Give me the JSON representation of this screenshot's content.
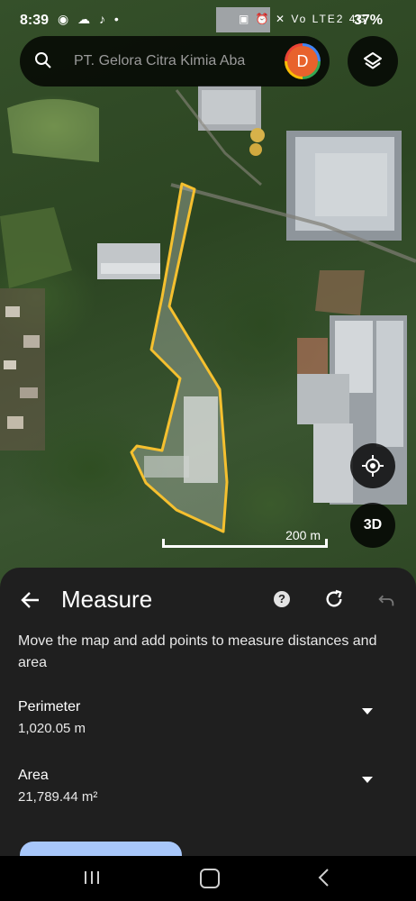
{
  "status_bar": {
    "time": "8:39",
    "left_icons": "◉ ☁ ♪ •",
    "right_icons": "▣ ⏰ ✕ Vo LTE2 4G",
    "battery": "37%"
  },
  "search": {
    "placeholder": "PT. Gelora Citra Kimia Aba"
  },
  "avatar": {
    "initial": "D",
    "color": "#e8622c"
  },
  "map": {
    "scale_label": "200 m",
    "button_3d": "3D"
  },
  "measure": {
    "title": "Measure",
    "help_glyph": "?",
    "instruction": "Move the map and add points to measure distances and area",
    "perimeter": {
      "label": "Perimeter",
      "value": "1,020.05 m"
    },
    "area": {
      "label": "Area",
      "value": "21,789.44 m²"
    }
  },
  "icons": {
    "search": "search-icon",
    "layers": "layers-icon",
    "location": "my-location-icon",
    "back": "arrow-back-icon",
    "help": "help-icon",
    "redo": "redo-icon",
    "undo": "undo-icon"
  },
  "colors": {
    "polygon": "#f5c02f",
    "sheet_bg": "#1f1f1f",
    "accent": "#a8c7fa"
  }
}
